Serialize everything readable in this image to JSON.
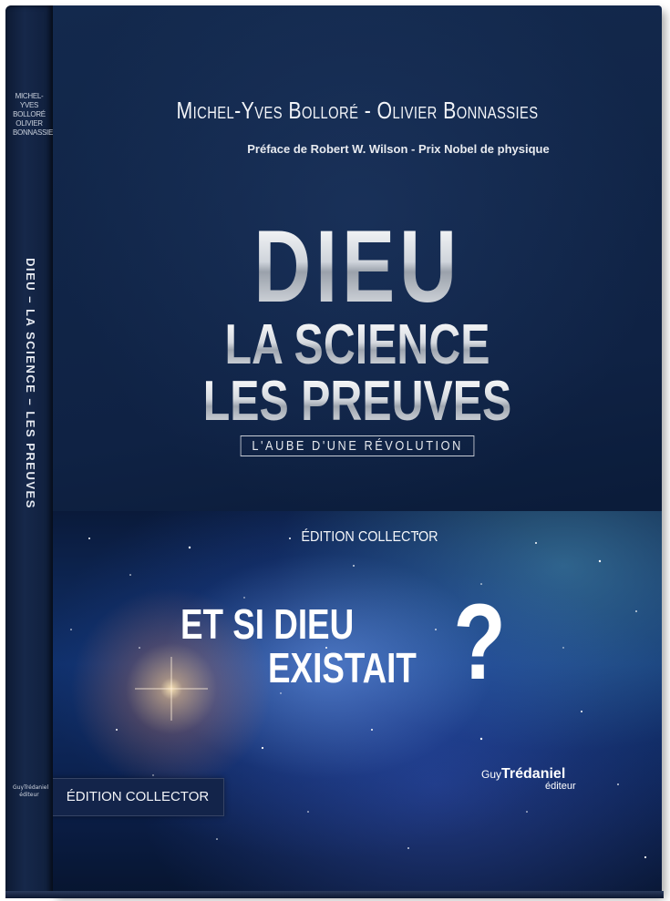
{
  "spine": {
    "author_lines": [
      "MICHEL-YVES",
      "BOLLORÉ",
      "OLIVIER",
      "BONNASSIES"
    ],
    "title": "DIEU – LA SCIENCE – LES PREUVES",
    "publisher_line1": "GuyTrédaniel",
    "publisher_line2": "éditeur"
  },
  "cover": {
    "authors": "Michel-Yves Bolloré - Olivier Bonnassies",
    "preface": "Préface de Robert W. Wilson - Prix Nobel de physique",
    "title_line1": "DIEU",
    "title_line2": "LA SCIENCE",
    "title_line3": "LES PREUVES",
    "subtitle": "L'AUBE D'UNE RÉVOLUTION",
    "edition_top": "ÉDITION COLLECTOR",
    "question_line1": "ET SI DIEU",
    "question_line2": "EXISTAIT",
    "question_mark": "?",
    "edition_band": "ÉDITION COLLECTOR",
    "publisher_guy": "Guy",
    "publisher_name": "Trédaniel",
    "publisher_editeur": "éditeur"
  },
  "colors": {
    "cover_navy": "#0f2244",
    "spine_navy": "#16284a",
    "text_white": "#ffffff",
    "title_silver": "#cfd4db"
  }
}
